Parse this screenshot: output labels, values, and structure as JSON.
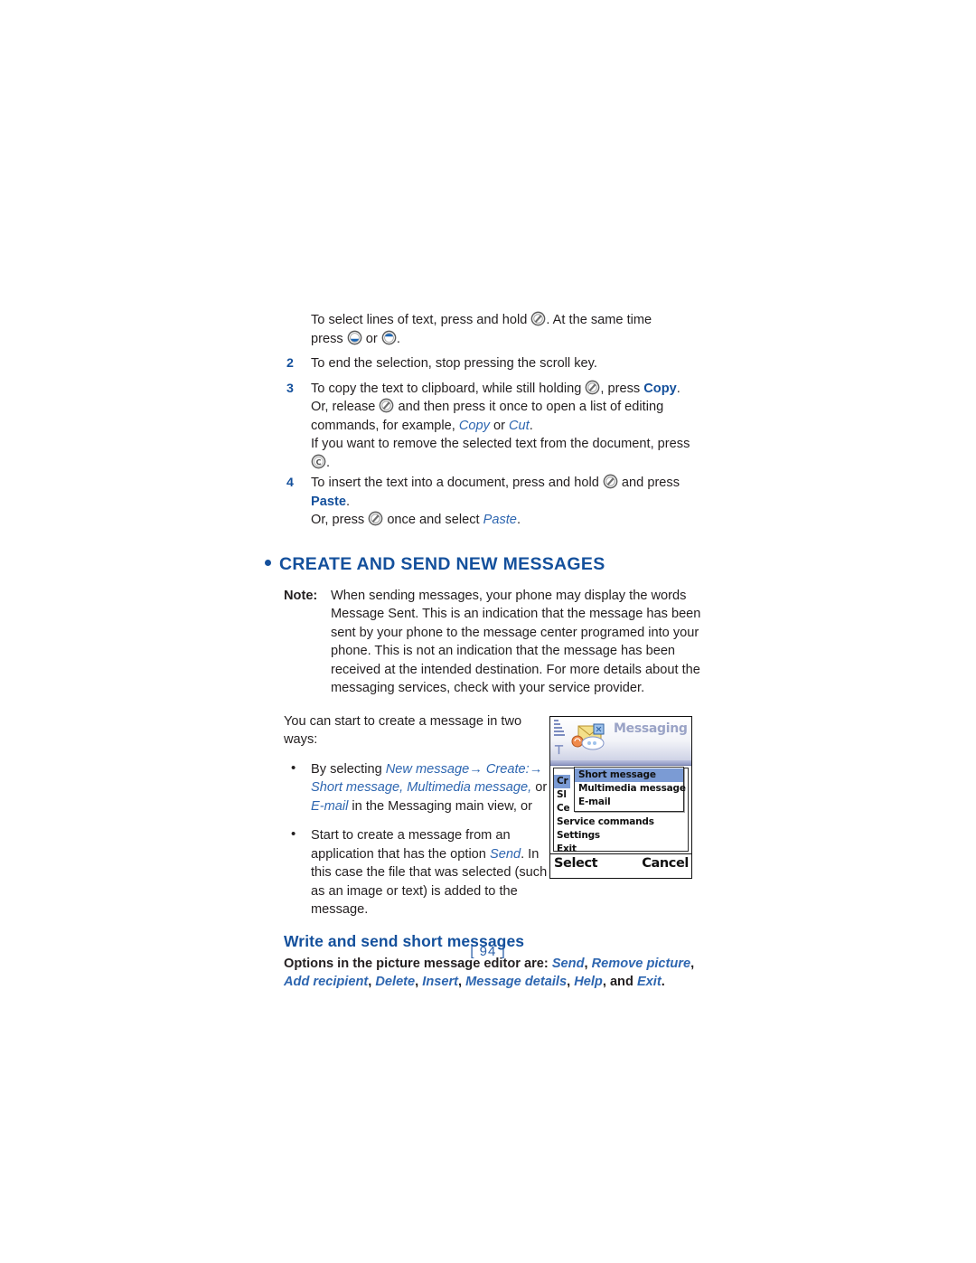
{
  "document": {
    "page_number": "[ 94 ]"
  },
  "steps": {
    "step1_cont": {
      "line1_a": "To select lines of text, press and hold ",
      "line1_b": ". At the same time",
      "line2_a": "press ",
      "line2_b": " or ",
      "line2_c": "."
    },
    "step2": {
      "num": "2",
      "text": "To end the selection, stop pressing the scroll key."
    },
    "step3": {
      "num": "3",
      "line1_a": "To copy the text to clipboard, while still holding ",
      "line1_b": ", press ",
      "line1_copy": "Copy",
      "line1_c": ".",
      "line2_a": "Or, release ",
      "line2_b": " and then press it once to open a list of editing",
      "line3_a": "commands, for example, ",
      "line3_copy": "Copy",
      "line3_b": " or ",
      "line3_cut": "Cut",
      "line3_c": ".",
      "line4_a": "If you want to remove the selected text from the document, press ",
      "line4_b": "."
    },
    "step4": {
      "num": "4",
      "line1_a": "To insert the text into a document, press and hold ",
      "line1_b": " and press",
      "paste": "Paste",
      "line2_period": ".",
      "line3_a": "Or, press ",
      "line3_b": " once and select ",
      "line3_paste": "Paste",
      "line3_c": "."
    }
  },
  "section": {
    "heading": "CREATE AND SEND NEW MESSAGES",
    "note_label": "Note:",
    "note_text": "When sending messages, your phone may display the words Message Sent. This is an indication that the message has been sent by your phone to the message center programed into your phone. This is not an indication that the message has been received at the intended destination. For more details about the messaging services, check with your service provider."
  },
  "ways": {
    "intro": "You can start to create a message in two ways:",
    "bullet1": {
      "a": "By selecting ",
      "new_message": "New message",
      "arrow1": "→",
      "create": " Create:",
      "arrow2": "→",
      "short_message": "Short message",
      "comma1": ", ",
      "multimedia_message": "Multimedia message",
      "comma2": ",",
      "or": "or ",
      "email": "E-mail",
      "tail": " in the Messaging main view, or"
    },
    "bullet2": {
      "a": "Start to create a message from an application that has the option ",
      "send": "Send",
      "b": ". In this case the file that was selected (such as an image or text) is added to the message."
    }
  },
  "phone_screenshot": {
    "title": "Messaging",
    "menu_items": [
      {
        "label": "Create message",
        "visible_text": "Cr",
        "selected": true
      },
      {
        "label": "SIM messages",
        "visible_text": "Sl",
        "selected": false
      },
      {
        "label": "Cell broadcast",
        "visible_text": "Ce",
        "selected": false
      },
      {
        "label": "Service commands",
        "visible_text": "Service commands",
        "selected": false
      },
      {
        "label": "Settings",
        "visible_text": "Settings",
        "selected": false
      },
      {
        "label": "Exit",
        "visible_text": "Exit",
        "selected": false
      }
    ],
    "submenu_items": [
      {
        "label": "Short message",
        "selected": true
      },
      {
        "label": "Multimedia message",
        "selected": false
      },
      {
        "label": "E-mail",
        "selected": false
      }
    ],
    "softkey_left": "Select",
    "softkey_right": "Cancel"
  },
  "subsection": {
    "heading": "Write and send short messages",
    "options_prefix": "Options in the picture message editor are: ",
    "options": [
      "Send",
      "Remove picture",
      "Add recipient",
      "Delete",
      "Insert",
      "Message details",
      "Help"
    ],
    "options_and": "and ",
    "options_last": "Exit",
    "options_period": "."
  },
  "colors": {
    "heading_blue": "#14509c",
    "link_blue": "#2e66b0",
    "body_text": "#231f20",
    "phone_highlight": "#7b9bd4"
  },
  "icons": {
    "pencil_key": "edit-pencil-key-icon",
    "scroll_up_key": "scroll-up-key-icon",
    "scroll_down_key": "scroll-down-key-icon",
    "clear_key": "clear-c-key-icon"
  }
}
